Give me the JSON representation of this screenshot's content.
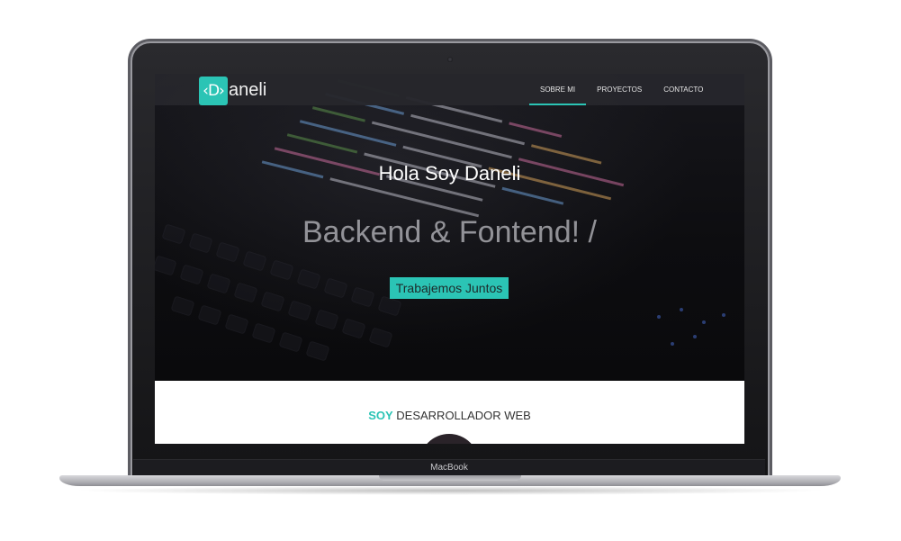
{
  "device": {
    "brand_label": "MacBook"
  },
  "site": {
    "logo": {
      "mark": "‹D›",
      "text": "aneli"
    },
    "nav": [
      {
        "label": "SOBRE MI",
        "active": true
      },
      {
        "label": "PROYECTOS",
        "active": false
      },
      {
        "label": "CONTACTO",
        "active": false
      }
    ],
    "hero": {
      "title": "Hola Soy Daneli",
      "subtitle": "Backend & Fontend! /",
      "cta_label": "Trabajemos Juntos"
    },
    "about": {
      "accent": "SOY",
      "rest": " DESARROLLADOR WEB"
    }
  },
  "colors": {
    "accent": "#2bc4b5",
    "navbar": "#26262c",
    "hero_bg": "#0d0d10"
  },
  "icons": [
    "camera-icon",
    "logo-mark-icon"
  ]
}
